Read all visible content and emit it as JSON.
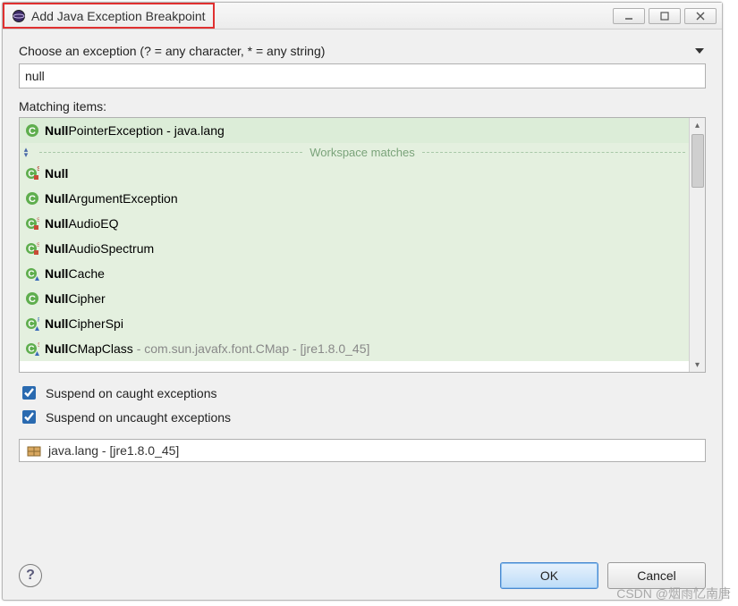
{
  "title": "Add Java Exception Breakpoint",
  "choose_label": "Choose an exception (? = any character, * = any string)",
  "search_value": "null",
  "matching_label": "Matching items:",
  "separator_label": "Workspace matches",
  "items": {
    "0": {
      "bold": "Null",
      "rest": "PointerException - java.lang"
    },
    "1": {
      "bold": "Null",
      "rest": ""
    },
    "2": {
      "bold": "Null",
      "rest": "ArgumentException"
    },
    "3": {
      "bold": "Null",
      "rest": "AudioEQ"
    },
    "4": {
      "bold": "Null",
      "rest": "AudioSpectrum"
    },
    "5": {
      "bold": "Null",
      "rest": "Cache"
    },
    "6": {
      "bold": "Null",
      "rest": "Cipher"
    },
    "7": {
      "bold": "Null",
      "rest": "CipherSpi"
    },
    "8": {
      "bold": "Null",
      "rest": "CMapClass",
      "meta": " - com.sun.javafx.font.CMap - [jre1.8.0_45]"
    }
  },
  "checkbox1": "Suspend on caught exceptions",
  "checkbox2": "Suspend on uncaught exceptions",
  "package_info": "java.lang - [jre1.8.0_45]",
  "ok_label": "OK",
  "cancel_label": "Cancel",
  "watermark": "CSDN @烟雨忆南唐"
}
